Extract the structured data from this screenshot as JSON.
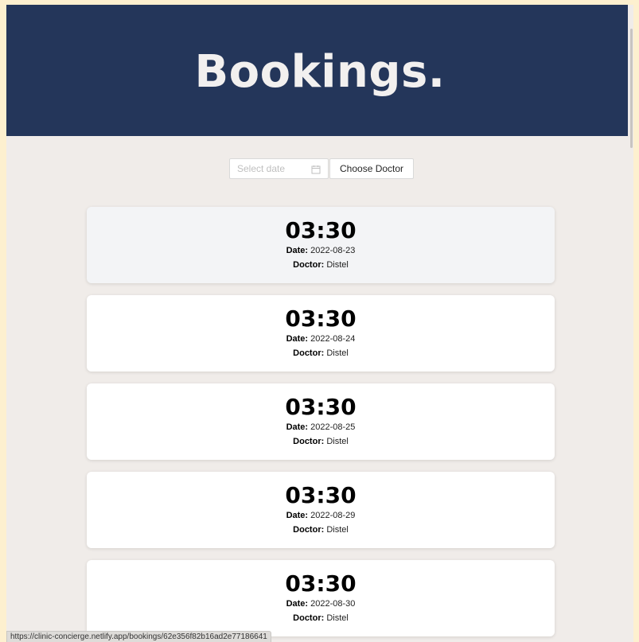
{
  "header": {
    "title": "Bookings."
  },
  "filters": {
    "date_placeholder": "Select date",
    "doctor_button_label": "Choose Doctor"
  },
  "labels": {
    "date": "Date:",
    "doctor": "Doctor:"
  },
  "bookings": [
    {
      "time": "03:30",
      "date": "2022-08-23",
      "doctor": "Distel"
    },
    {
      "time": "03:30",
      "date": "2022-08-24",
      "doctor": "Distel"
    },
    {
      "time": "03:30",
      "date": "2022-08-25",
      "doctor": "Distel"
    },
    {
      "time": "03:30",
      "date": "2022-08-29",
      "doctor": "Distel"
    },
    {
      "time": "03:30",
      "date": "2022-08-30",
      "doctor": "Distel"
    }
  ],
  "status_bar": {
    "url": "https://clinic-concierge.netlify.app/bookings/62e356f82b16ad2e77186641"
  },
  "colors": {
    "header_bg": "#24365a",
    "page_bg": "#f0ece9",
    "card_bg": "#ffffff",
    "card_hover_bg": "#f3f4f6"
  },
  "icons": {
    "date_picker": "calendar-icon"
  }
}
